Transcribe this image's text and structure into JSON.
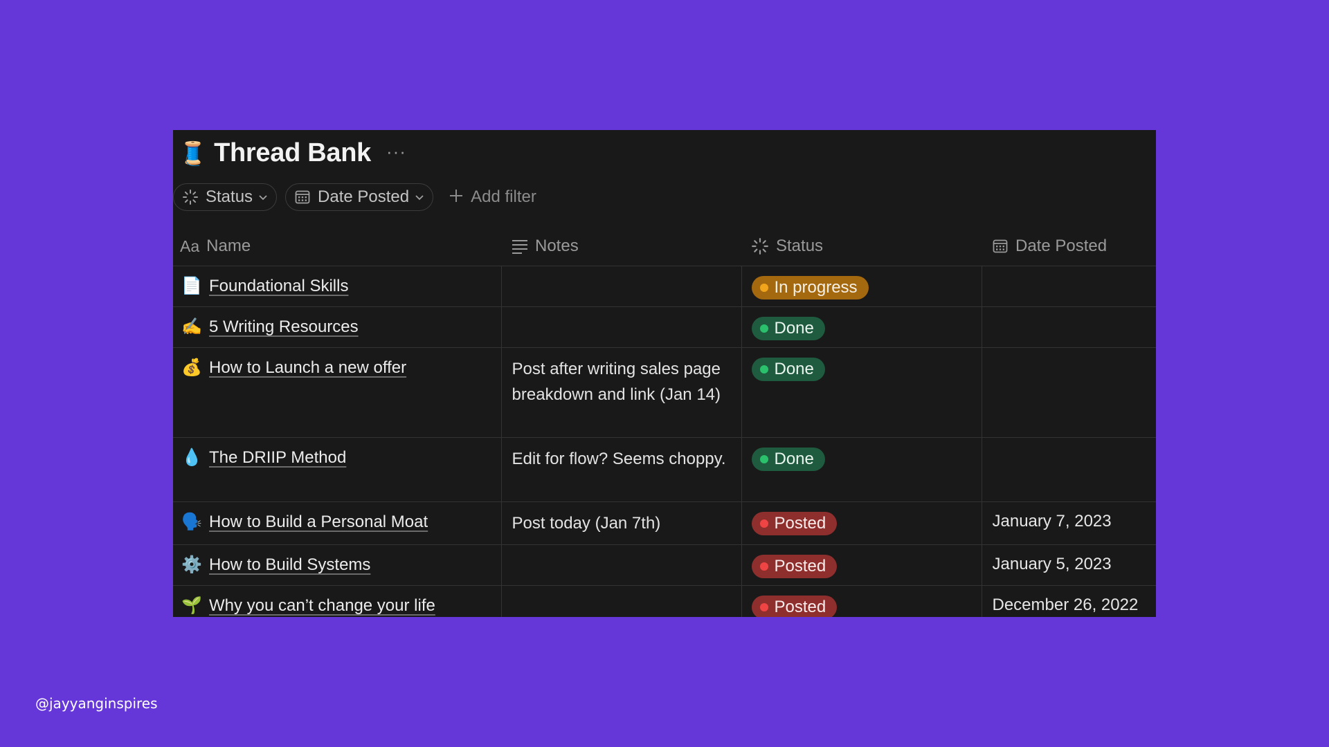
{
  "page": {
    "title_emoji": "🧵",
    "title": "Thread Bank",
    "more_label": "···"
  },
  "filters": {
    "status_label": "Status",
    "date_label": "Date Posted",
    "add_label": "Add filter"
  },
  "columns": {
    "name_prefix": "Aa",
    "name": "Name",
    "notes": "Notes",
    "status": "Status",
    "date": "Date Posted"
  },
  "rows": [
    {
      "emoji": "📄",
      "name": "Foundational Skills",
      "notes": "",
      "status": "In progress",
      "status_kind": "progress",
      "date": ""
    },
    {
      "emoji": "✍️",
      "name": "5 Writing Resources",
      "notes": "",
      "status": "Done",
      "status_kind": "done",
      "date": ""
    },
    {
      "emoji": "💰",
      "name": "How to Launch a new offer",
      "notes": "Post after writing sales page breakdown and link (Jan 14)",
      "status": "Done",
      "status_kind": "done",
      "date": ""
    },
    {
      "emoji": "💧",
      "name": "The DRIIP Method",
      "notes": "Edit for flow? Seems choppy.",
      "status": "Done",
      "status_kind": "done",
      "date": ""
    },
    {
      "emoji": "🗣️",
      "name": "How to Build a Personal Moat",
      "notes": "Post today (Jan 7th)",
      "status": "Posted",
      "status_kind": "posted",
      "date": "January 7, 2023"
    },
    {
      "emoji": "⚙️",
      "name": "How to Build Systems",
      "notes": "",
      "status": "Posted",
      "status_kind": "posted",
      "date": "January 5, 2023"
    },
    {
      "emoji": "🌱",
      "name": "Why you can’t change your life",
      "notes": "",
      "status": "Posted",
      "status_kind": "posted",
      "date": "December 26, 2022"
    }
  ],
  "status_colors": {
    "progress": {
      "bg": "#a4680f",
      "dot": "#f0a51c",
      "text": "#f7f0e4"
    },
    "done": {
      "bg": "#1f5b3f",
      "dot": "#2bc06b",
      "text": "#eaf6ef"
    },
    "posted": {
      "bg": "#8f2f2d",
      "dot": "#ef4444",
      "text": "#f9eceb"
    }
  },
  "footer": {
    "handle": "@jayyanginspires"
  },
  "colors": {
    "background": "#6637d8",
    "panel": "#191919"
  }
}
